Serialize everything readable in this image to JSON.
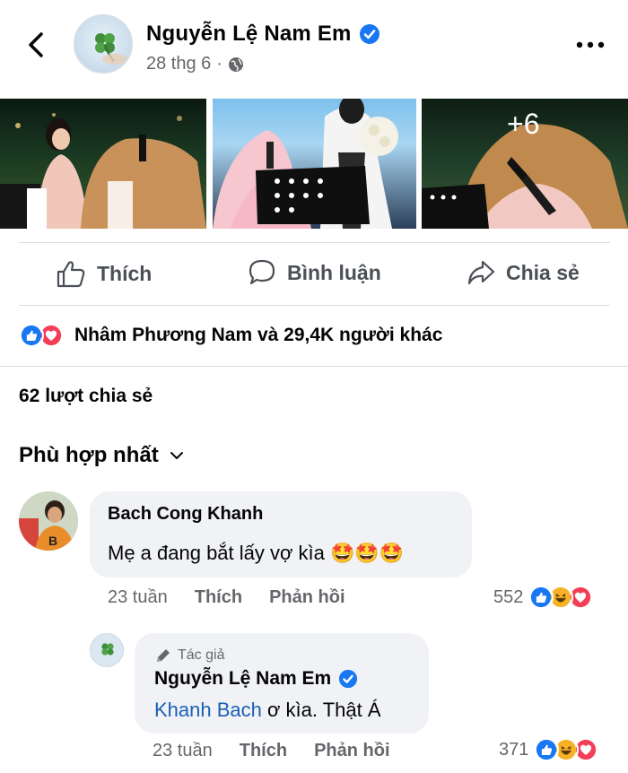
{
  "post": {
    "author": "Nguyễn Lệ Nam Em",
    "date": "28 thg 6",
    "separator": "·",
    "photos_more": "+6"
  },
  "actions": {
    "like": "Thích",
    "comment": "Bình luận",
    "share": "Chia sẻ"
  },
  "reactions": {
    "summary": "Nhâm Phương Nam và 29,4K người khác"
  },
  "shares": "62 lượt chia sẻ",
  "sort": {
    "label": "Phù hợp nhất"
  },
  "comments": [
    {
      "author": "Bach Cong Khanh",
      "text": "Mẹ a đang bắt lấy vợ kìa 🤩🤩🤩",
      "time": "23 tuần",
      "like": "Thích",
      "reply": "Phản hồi",
      "reaction_count": "552"
    },
    {
      "author_tag": "Tác giả",
      "author": "Nguyễn Lệ Nam Em",
      "mention": "Khanh Bach",
      "text": " ơ kìa. Thật Á",
      "time": "23 tuần",
      "like": "Thích",
      "reply": "Phản hồi",
      "reaction_count": "371"
    }
  ],
  "colors": {
    "facebook_blue": "#1877f2",
    "love_red": "#f33e58",
    "haha_yellow": "#f7b125",
    "secondary_text": "#65676b",
    "divider": "#dadde1"
  }
}
